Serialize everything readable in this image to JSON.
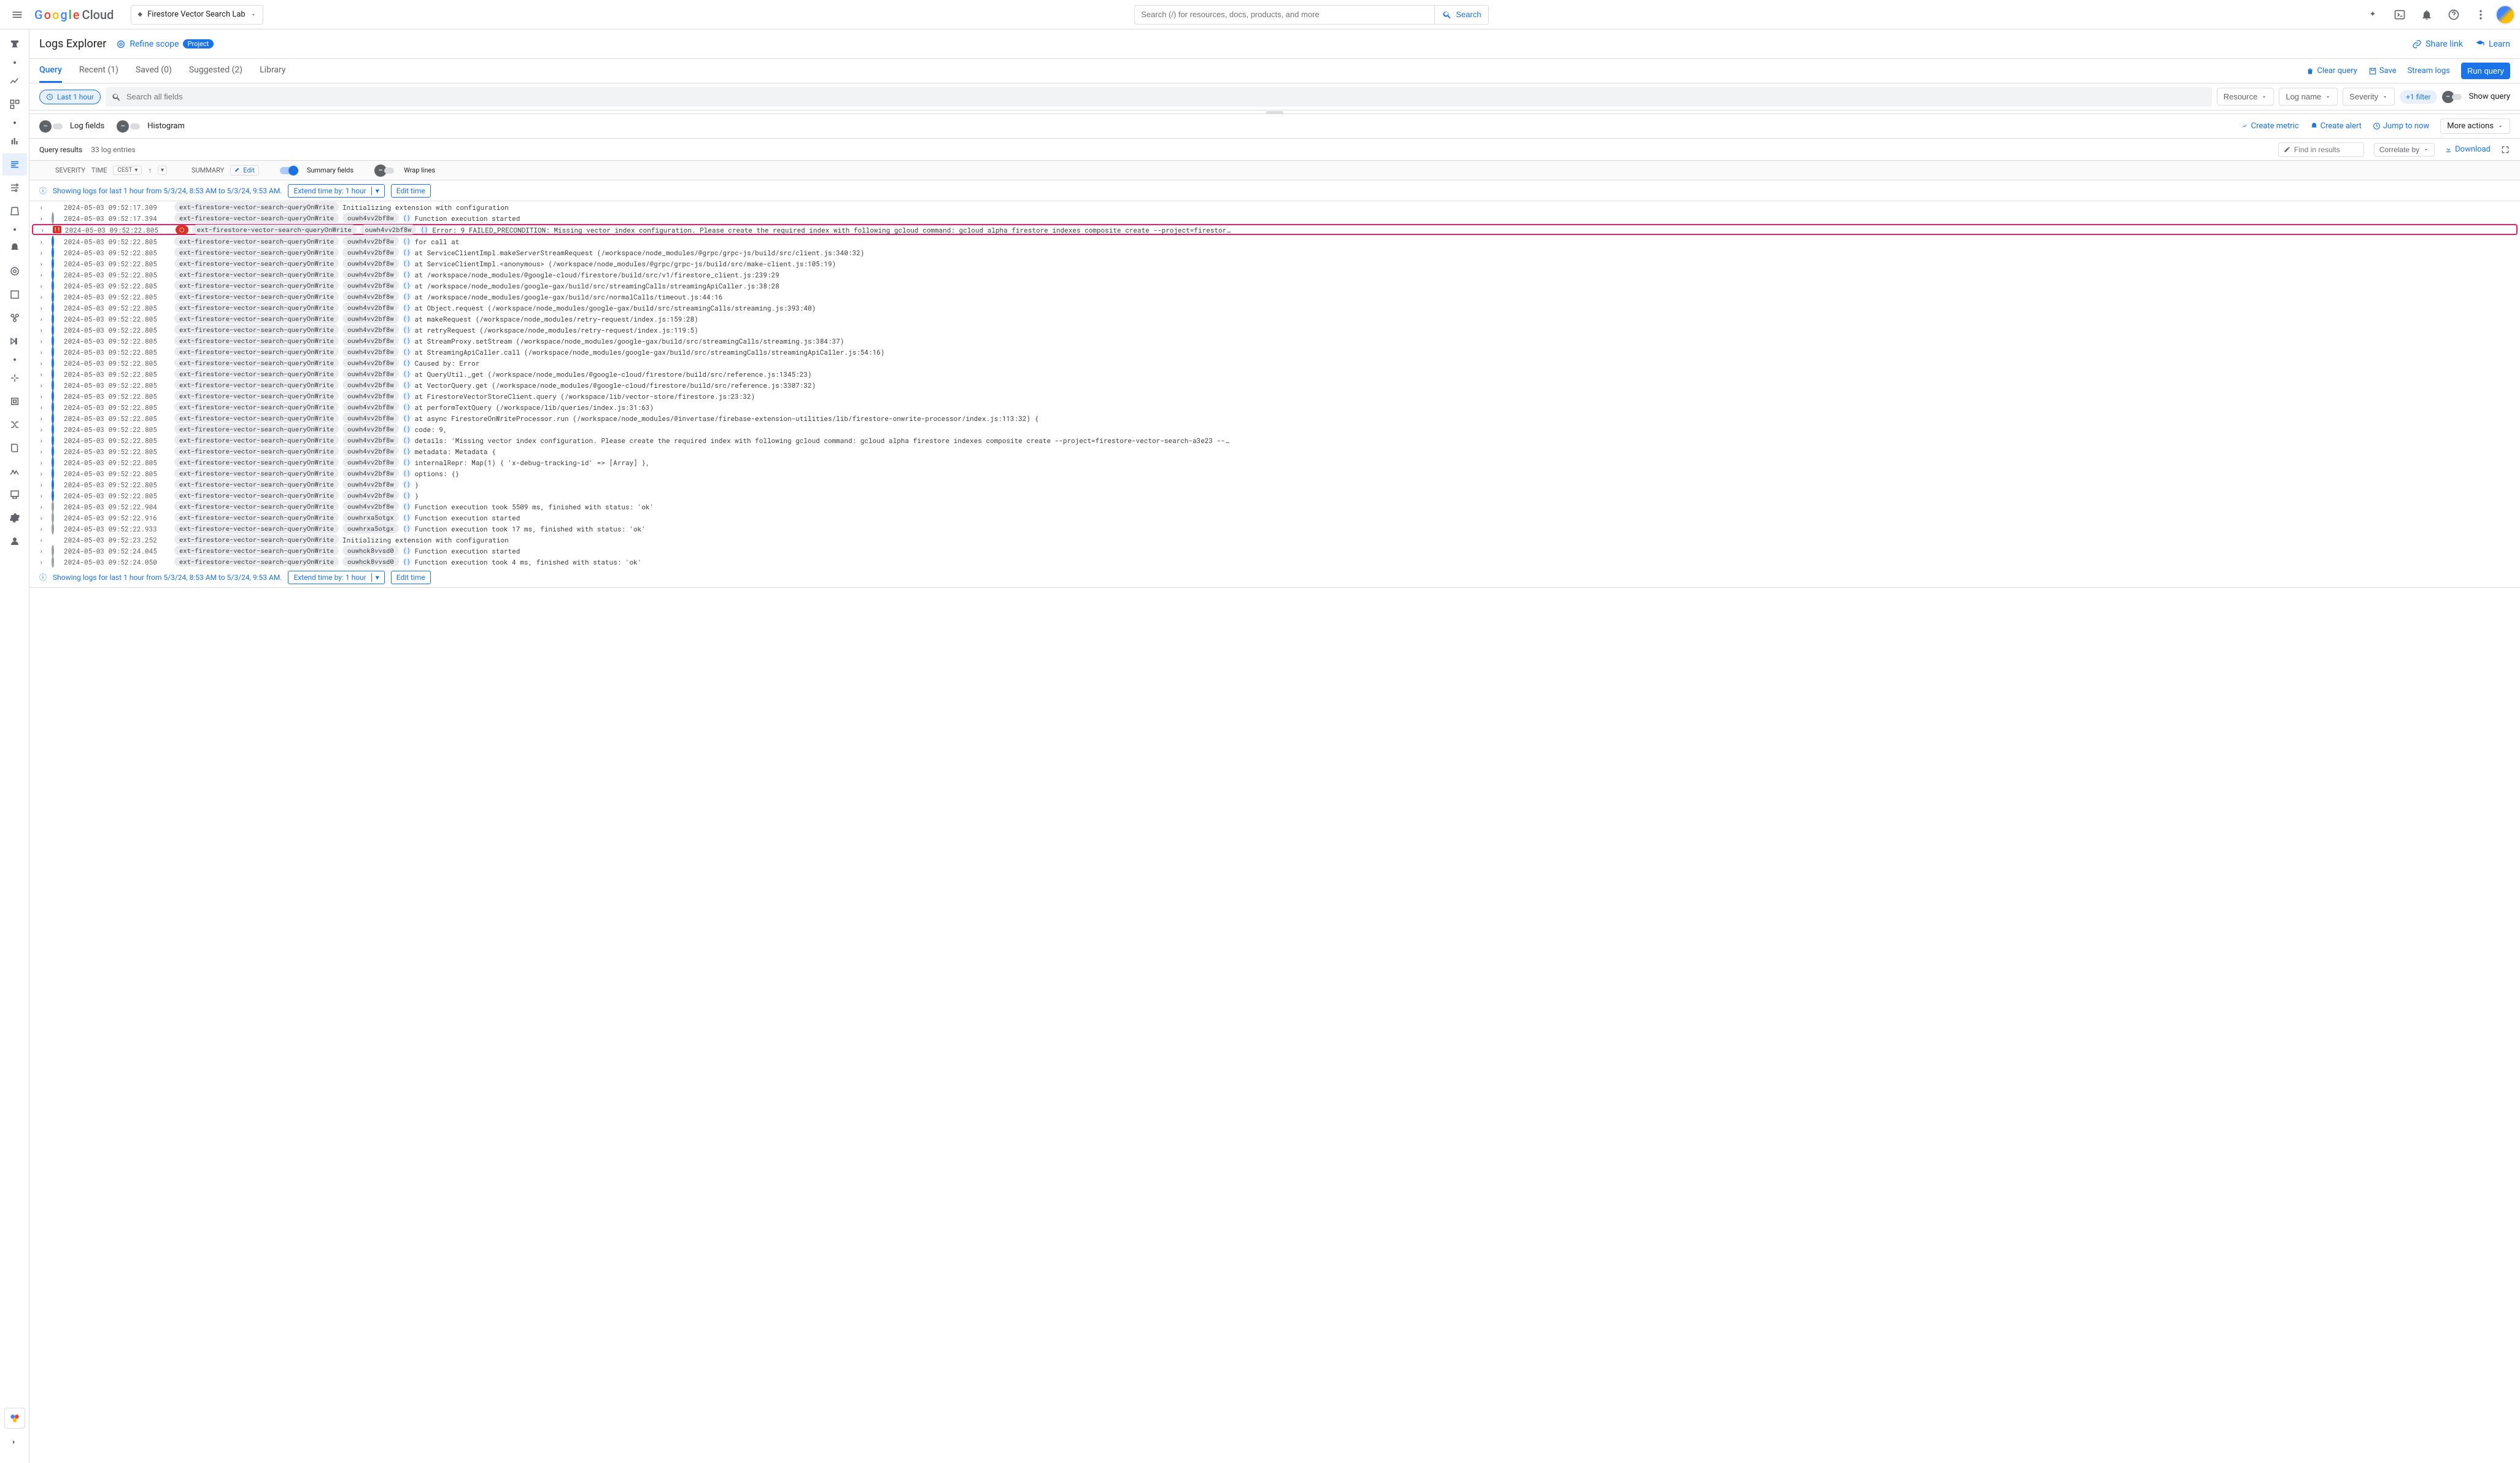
{
  "top": {
    "project_name": "Firestore Vector Search Lab",
    "search_placeholder": "Search (/) for resources, docs, products, and more",
    "search_btn": "Search"
  },
  "header": {
    "title": "Logs Explorer",
    "refine_scope": "Refine scope",
    "scope_pill": "Project",
    "share_link": "Share link",
    "learn": "Learn"
  },
  "tabs": {
    "items": [
      "Query",
      "Recent (1)",
      "Saved (0)",
      "Suggested (2)",
      "Library"
    ],
    "clear": "Clear query",
    "save": "Save",
    "stream": "Stream logs",
    "run": "Run query"
  },
  "filter": {
    "time_chip": "Last 1 hour",
    "search_placeholder": "Search all fields",
    "resource": "Resource",
    "log_name": "Log name",
    "severity": "Severity",
    "plus_filter": "+1 filter",
    "show_query": "Show query"
  },
  "panels": {
    "log_fields": "Log fields",
    "histogram": "Histogram",
    "create_metric": "Create metric",
    "create_alert": "Create alert",
    "jump_to_now": "Jump to now",
    "more_actions": "More actions"
  },
  "qr": {
    "title": "Query results",
    "count": "33 log entries",
    "find_placeholder": "Find in results",
    "correlate": "Correlate by",
    "download": "Download"
  },
  "colhdr": {
    "severity": "SEVERITY",
    "time": "TIME",
    "cest": "CEST",
    "summary": "SUMMARY",
    "edit": "Edit",
    "summary_fields": "Summary fields",
    "wrap_lines": "Wrap lines"
  },
  "banner": {
    "text": "Showing logs for last 1 hour from 5/3/24, 8:53 AM to 5/3/24, 9:53 AM.",
    "extend": "Extend time by: 1 hour",
    "edit_time": "Edit time"
  },
  "logs": [
    {
      "sev": "info",
      "ts": "2024-05-03 09:52:17.309",
      "fn": "ext-firestore-vector-search-queryOnWrite",
      "exec": "",
      "cf": false,
      "msg": "Initializing extension with configuration"
    },
    {
      "sev": "debug",
      "ts": "2024-05-03 09:52:17.394",
      "fn": "ext-firestore-vector-search-queryOnWrite",
      "exec": "ouwh4vv2bf8w",
      "cf": true,
      "msg": "Function execution started"
    },
    {
      "sev": "error",
      "ts": "2024-05-03 09:52:22.805",
      "fn": "ext-firestore-vector-search-queryOnWrite",
      "exec": "ouwh4vv2bf8w",
      "cf": true,
      "err": true,
      "highlight": true,
      "msg": "Error: 9 FAILED_PRECONDITION: Missing vector index configuration. Please create the required index with following gcloud command: gcloud alpha firestore indexes composite create --project=firestor…"
    },
    {
      "sev": "blue",
      "ts": "2024-05-03 09:52:22.805",
      "fn": "ext-firestore-vector-search-queryOnWrite",
      "exec": "ouwh4vv2bf8w",
      "cf": true,
      "msg": "for call at"
    },
    {
      "sev": "blue",
      "ts": "2024-05-03 09:52:22.805",
      "fn": "ext-firestore-vector-search-queryOnWrite",
      "exec": "ouwh4vv2bf8w",
      "cf": true,
      "msg": "    at ServiceClientImpl.makeServerStreamRequest (/workspace/node_modules/@grpc/grpc-js/build/src/client.js:340:32)"
    },
    {
      "sev": "blue",
      "ts": "2024-05-03 09:52:22.805",
      "fn": "ext-firestore-vector-search-queryOnWrite",
      "exec": "ouwh4vv2bf8w",
      "cf": true,
      "msg": "    at ServiceClientImpl.<anonymous> (/workspace/node_modules/@grpc/grpc-js/build/src/make-client.js:105:19)"
    },
    {
      "sev": "blue",
      "ts": "2024-05-03 09:52:22.805",
      "fn": "ext-firestore-vector-search-queryOnWrite",
      "exec": "ouwh4vv2bf8w",
      "cf": true,
      "msg": "    at /workspace/node_modules/@google-cloud/firestore/build/src/v1/firestore_client.js:239:29"
    },
    {
      "sev": "blue",
      "ts": "2024-05-03 09:52:22.805",
      "fn": "ext-firestore-vector-search-queryOnWrite",
      "exec": "ouwh4vv2bf8w",
      "cf": true,
      "msg": "    at /workspace/node_modules/google-gax/build/src/streamingCalls/streamingApiCaller.js:38:28"
    },
    {
      "sev": "blue",
      "ts": "2024-05-03 09:52:22.805",
      "fn": "ext-firestore-vector-search-queryOnWrite",
      "exec": "ouwh4vv2bf8w",
      "cf": true,
      "msg": "    at /workspace/node_modules/google-gax/build/src/normalCalls/timeout.js:44:16"
    },
    {
      "sev": "blue",
      "ts": "2024-05-03 09:52:22.805",
      "fn": "ext-firestore-vector-search-queryOnWrite",
      "exec": "ouwh4vv2bf8w",
      "cf": true,
      "msg": "    at Object.request (/workspace/node_modules/google-gax/build/src/streamingCalls/streaming.js:393:40)"
    },
    {
      "sev": "blue",
      "ts": "2024-05-03 09:52:22.805",
      "fn": "ext-firestore-vector-search-queryOnWrite",
      "exec": "ouwh4vv2bf8w",
      "cf": true,
      "msg": "    at makeRequest (/workspace/node_modules/retry-request/index.js:159:28)"
    },
    {
      "sev": "blue",
      "ts": "2024-05-03 09:52:22.805",
      "fn": "ext-firestore-vector-search-queryOnWrite",
      "exec": "ouwh4vv2bf8w",
      "cf": true,
      "msg": "    at retryRequest (/workspace/node_modules/retry-request/index.js:119:5)"
    },
    {
      "sev": "blue",
      "ts": "2024-05-03 09:52:22.805",
      "fn": "ext-firestore-vector-search-queryOnWrite",
      "exec": "ouwh4vv2bf8w",
      "cf": true,
      "msg": "    at StreamProxy.setStream (/workspace/node_modules/google-gax/build/src/streamingCalls/streaming.js:384:37)"
    },
    {
      "sev": "blue",
      "ts": "2024-05-03 09:52:22.805",
      "fn": "ext-firestore-vector-search-queryOnWrite",
      "exec": "ouwh4vv2bf8w",
      "cf": true,
      "msg": "    at StreamingApiCaller.call (/workspace/node_modules/google-gax/build/src/streamingCalls/streamingApiCaller.js:54:16)"
    },
    {
      "sev": "blue",
      "ts": "2024-05-03 09:52:22.805",
      "fn": "ext-firestore-vector-search-queryOnWrite",
      "exec": "ouwh4vv2bf8w",
      "cf": true,
      "msg": "Caused by: Error"
    },
    {
      "sev": "blue",
      "ts": "2024-05-03 09:52:22.805",
      "fn": "ext-firestore-vector-search-queryOnWrite",
      "exec": "ouwh4vv2bf8w",
      "cf": true,
      "msg": "    at QueryUtil._get (/workspace/node_modules/@google-cloud/firestore/build/src/reference.js:1345:23)"
    },
    {
      "sev": "blue",
      "ts": "2024-05-03 09:52:22.805",
      "fn": "ext-firestore-vector-search-queryOnWrite",
      "exec": "ouwh4vv2bf8w",
      "cf": true,
      "msg": "    at VectorQuery.get (/workspace/node_modules/@google-cloud/firestore/build/src/reference.js:3307:32)"
    },
    {
      "sev": "blue",
      "ts": "2024-05-03 09:52:22.805",
      "fn": "ext-firestore-vector-search-queryOnWrite",
      "exec": "ouwh4vv2bf8w",
      "cf": true,
      "msg": "    at FirestoreVectorStoreClient.query (/workspace/lib/vector-store/firestore.js:23:32)"
    },
    {
      "sev": "blue",
      "ts": "2024-05-03 09:52:22.805",
      "fn": "ext-firestore-vector-search-queryOnWrite",
      "exec": "ouwh4vv2bf8w",
      "cf": true,
      "msg": "    at performTextQuery (/workspace/lib/queries/index.js:31:63)"
    },
    {
      "sev": "blue",
      "ts": "2024-05-03 09:52:22.805",
      "fn": "ext-firestore-vector-search-queryOnWrite",
      "exec": "ouwh4vv2bf8w",
      "cf": true,
      "msg": "    at async FirestoreOnWriteProcessor.run (/workspace/node_modules/@invertase/firebase-extension-utilities/lib/firestore-onwrite-processor/index.js:113:32) {"
    },
    {
      "sev": "blue",
      "ts": "2024-05-03 09:52:22.805",
      "fn": "ext-firestore-vector-search-queryOnWrite",
      "exec": "ouwh4vv2bf8w",
      "cf": true,
      "msg": "  code: 9,"
    },
    {
      "sev": "blue",
      "ts": "2024-05-03 09:52:22.805",
      "fn": "ext-firestore-vector-search-queryOnWrite",
      "exec": "ouwh4vv2bf8w",
      "cf": true,
      "msg": "  details: 'Missing vector index configuration. Please create the required index with following gcloud command: gcloud alpha firestore indexes composite create --project=firestore-vector-search-a3e23 --…"
    },
    {
      "sev": "blue",
      "ts": "2024-05-03 09:52:22.805",
      "fn": "ext-firestore-vector-search-queryOnWrite",
      "exec": "ouwh4vv2bf8w",
      "cf": true,
      "msg": "  metadata: Metadata {"
    },
    {
      "sev": "blue",
      "ts": "2024-05-03 09:52:22.805",
      "fn": "ext-firestore-vector-search-queryOnWrite",
      "exec": "ouwh4vv2bf8w",
      "cf": true,
      "msg": "    internalRepr: Map(1) { 'x-debug-tracking-id' => [Array] },"
    },
    {
      "sev": "blue",
      "ts": "2024-05-03 09:52:22.805",
      "fn": "ext-firestore-vector-search-queryOnWrite",
      "exec": "ouwh4vv2bf8w",
      "cf": true,
      "msg": "    options: {}"
    },
    {
      "sev": "blue",
      "ts": "2024-05-03 09:52:22.805",
      "fn": "ext-firestore-vector-search-queryOnWrite",
      "exec": "ouwh4vv2bf8w",
      "cf": true,
      "msg": "  }"
    },
    {
      "sev": "blue",
      "ts": "2024-05-03 09:52:22.805",
      "fn": "ext-firestore-vector-search-queryOnWrite",
      "exec": "ouwh4vv2bf8w",
      "cf": true,
      "msg": "}"
    },
    {
      "sev": "debug",
      "ts": "2024-05-03 09:52:22.904",
      "fn": "ext-firestore-vector-search-queryOnWrite",
      "exec": "ouwh4vv2bf8w",
      "cf": true,
      "msg": "Function execution took 5509 ms, finished with status: 'ok'"
    },
    {
      "sev": "debug",
      "ts": "2024-05-03 09:52:22.916",
      "fn": "ext-firestore-vector-search-queryOnWrite",
      "exec": "ouwhrxa5otgx",
      "cf": true,
      "msg": "Function execution started"
    },
    {
      "sev": "debug",
      "ts": "2024-05-03 09:52:22.933",
      "fn": "ext-firestore-vector-search-queryOnWrite",
      "exec": "ouwhrxa5otgx",
      "cf": true,
      "msg": "Function execution took 17 ms, finished with status: 'ok'"
    },
    {
      "sev": "info",
      "ts": "2024-05-03 09:52:23.252",
      "fn": "ext-firestore-vector-search-queryOnWrite",
      "exec": "",
      "cf": false,
      "msg": "Initializing extension with configuration"
    },
    {
      "sev": "debug",
      "ts": "2024-05-03 09:52:24.045",
      "fn": "ext-firestore-vector-search-queryOnWrite",
      "exec": "ouwhck8vvsd0",
      "cf": true,
      "msg": "Function execution started"
    },
    {
      "sev": "debug",
      "ts": "2024-05-03 09:52:24.050",
      "fn": "ext-firestore-vector-search-queryOnWrite",
      "exec": "ouwhck8vvsd0",
      "cf": true,
      "msg": "Function execution took 4 ms, finished with status: 'ok'"
    }
  ]
}
